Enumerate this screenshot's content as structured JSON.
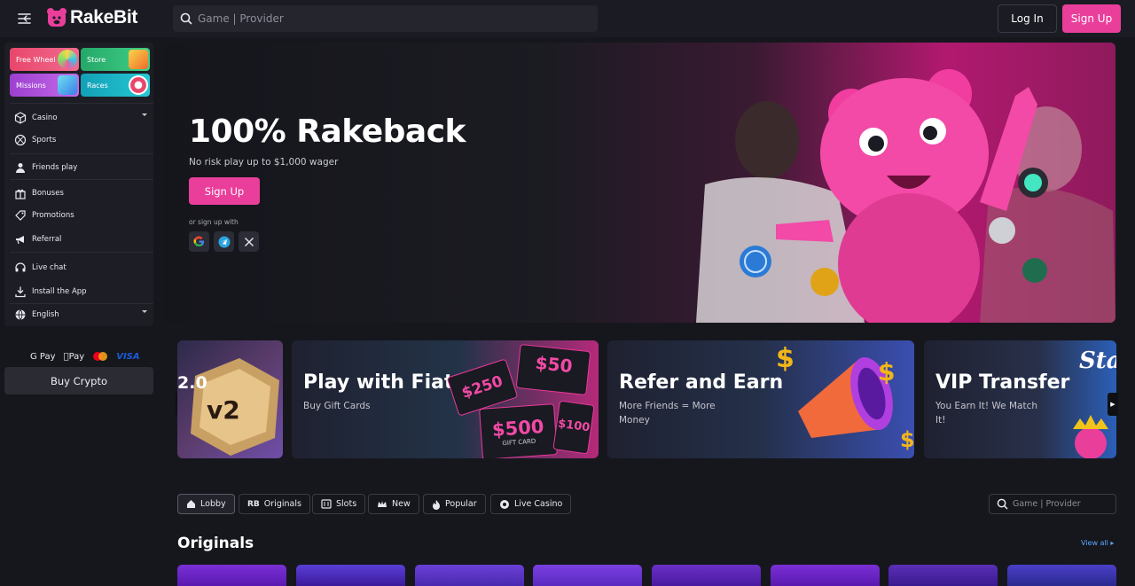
{
  "header": {
    "brand": "RakeBit",
    "search_placeholder": "Game | Provider",
    "login_label": "Log In",
    "signup_label": "Sign Up"
  },
  "sidebar": {
    "tiles": [
      {
        "label": "Free Wheel",
        "color": "#e9466b"
      },
      {
        "label": "Store",
        "color": "#2bb673"
      },
      {
        "label": "Missions",
        "color": "#b04ad6"
      },
      {
        "label": "Races",
        "color": "#16a3b8"
      }
    ],
    "items": [
      {
        "label": "Casino",
        "icon": "cube-icon",
        "caret": true
      },
      {
        "label": "Sports",
        "icon": "ball-icon"
      },
      {
        "label": "Friends play",
        "icon": "user-icon"
      },
      {
        "label": "Bonuses",
        "icon": "gift-icon"
      },
      {
        "label": "Promotions",
        "icon": "tag-icon"
      },
      {
        "label": "Referral",
        "icon": "megaphone-icon"
      },
      {
        "label": "Live chat",
        "icon": "headset-icon"
      },
      {
        "label": "Install the App",
        "icon": "download-icon"
      },
      {
        "label": "English",
        "icon": "globe-icon",
        "caret": true
      }
    ],
    "payments": [
      "G Pay",
      "Pay",
      "VISA"
    ],
    "buy_crypto": "Buy Crypto"
  },
  "hero": {
    "title": "100% Rakeback",
    "subtitle": "No risk play up to $1,000 wager",
    "cta": "Sign Up",
    "or_sign_up": "or sign up with",
    "socials": [
      "google-icon",
      "telegram-icon",
      "x-icon"
    ]
  },
  "promos": [
    {
      "badge": "2.0",
      "big": "v2"
    },
    {
      "title": "Play with Fiat",
      "subtitle": "Buy Gift Cards",
      "cards": [
        "$50",
        "$250",
        "$500",
        "$100"
      ],
      "card_label": "GIFT CARD"
    },
    {
      "title": "Refer and Earn",
      "subtitle": "More Friends = More Money"
    },
    {
      "title": "VIP Transfer",
      "subtitle": "You Earn It! We Match It!",
      "brand": "Stak"
    }
  ],
  "tabs": [
    "Lobby",
    "Originals",
    "Slots",
    "New",
    "Popular",
    "Live Casino"
  ],
  "games_search_placeholder": "Game | Provider",
  "section": {
    "title": "Originals",
    "view_all": "View all"
  },
  "colors": {
    "accent": "#ea3e9b",
    "bg": "#16171d",
    "panel": "#1d1e25"
  }
}
